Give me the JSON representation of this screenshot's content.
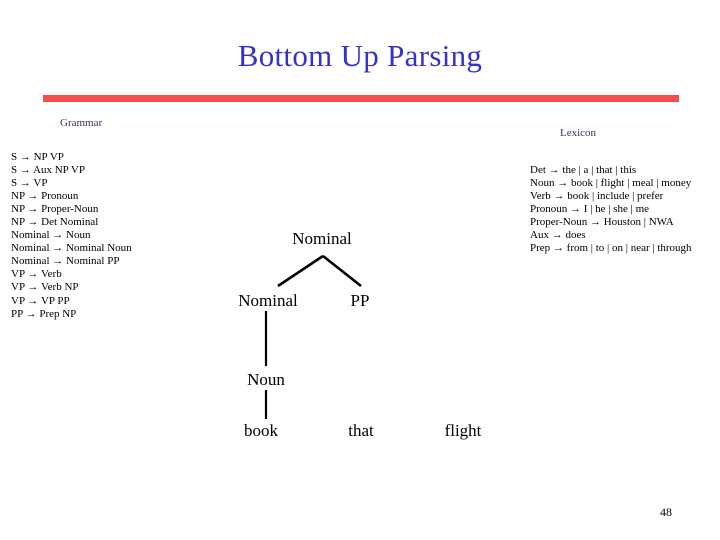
{
  "slide": {
    "title": "Bottom Up Parsing",
    "page_number": "48",
    "accent_rule_color": "#f44d4d",
    "title_color": "#3333cc",
    "label_color": "#333366"
  },
  "grammar": {
    "label": "Grammar",
    "rules": [
      "S → NP VP",
      "S → Aux NP VP",
      "S → VP",
      "NP → Pronoun",
      "NP → Proper-Noun",
      "NP → Det Nominal",
      "Nominal → Noun",
      "Nominal → Nominal Noun",
      "Nominal → Nominal PP",
      "VP → Verb",
      "VP → Verb NP",
      "VP → VP PP",
      "PP → Prep NP"
    ]
  },
  "lexicon": {
    "label": "Lexicon",
    "rules": [
      "Det → the | a | that | this",
      "Noun → book | flight | meal | money",
      "Verb → book | include | prefer",
      "Pronoun → I | he | she | me",
      "Proper-Noun → Houston | NWA",
      "Aux → does",
      "Prep → from | to | on | near | through"
    ]
  },
  "parse_tree": {
    "nodes": {
      "nominal_top": "Nominal",
      "nominal_mid": "Nominal",
      "pp": "PP",
      "noun": "Noun"
    },
    "leaves": {
      "book": "book",
      "that": "that",
      "flight": "flight"
    }
  }
}
